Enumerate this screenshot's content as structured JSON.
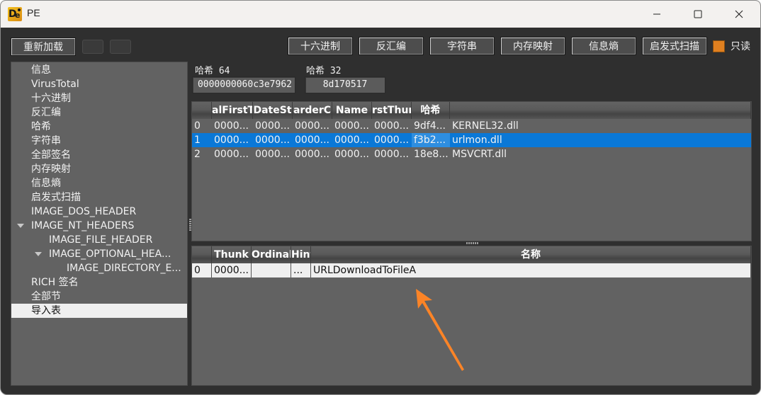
{
  "window": {
    "title": "PE",
    "controls": {
      "minimize": "—",
      "maximize": "☐",
      "close": "✕"
    }
  },
  "toolbar": {
    "reload_label": "重新加载",
    "buttons": [
      "十六进制",
      "反汇编",
      "字符串",
      "内存映射",
      "信息熵",
      "启发式扫描"
    ],
    "readonly_label": "只读",
    "readonly_checked": true,
    "readonly_color": "#e08020"
  },
  "sidebar": {
    "items": [
      {
        "label": "信息",
        "level": 0,
        "expandable": false
      },
      {
        "label": "VirusTotal",
        "level": 0,
        "expandable": false
      },
      {
        "label": "十六进制",
        "level": 0,
        "expandable": false
      },
      {
        "label": "反汇编",
        "level": 0,
        "expandable": false
      },
      {
        "label": "哈希",
        "level": 0,
        "expandable": false
      },
      {
        "label": "字符串",
        "level": 0,
        "expandable": false
      },
      {
        "label": "全部签名",
        "level": 0,
        "expandable": false
      },
      {
        "label": "内存映射",
        "level": 0,
        "expandable": false
      },
      {
        "label": "信息熵",
        "level": 0,
        "expandable": false
      },
      {
        "label": "启发式扫描",
        "level": 0,
        "expandable": false
      },
      {
        "label": "IMAGE_DOS_HEADER",
        "level": 0,
        "expandable": false
      },
      {
        "label": "IMAGE_NT_HEADERS",
        "level": 0,
        "expandable": true
      },
      {
        "label": "IMAGE_FILE_HEADER",
        "level": 1,
        "expandable": false
      },
      {
        "label": "IMAGE_OPTIONAL_HEA...",
        "level": 1,
        "expandable": true
      },
      {
        "label": "IMAGE_DIRECTORY_E...",
        "level": 2,
        "expandable": false
      },
      {
        "label": "RICH 签名",
        "level": 0,
        "expandable": false
      },
      {
        "label": "全部节",
        "level": 0,
        "expandable": false
      },
      {
        "label": "导入表",
        "level": 0,
        "expandable": false,
        "selected": true
      }
    ]
  },
  "hashes": {
    "hash64_label": "哈希 64",
    "hash64_value": "0000000060c3e7962",
    "hash32_label": "哈希 32",
    "hash32_value": "8d170517"
  },
  "imports_table": {
    "columns": [
      "",
      "alFirstT",
      "DateSt",
      "arderC",
      "Name",
      "rstThur",
      "哈希",
      ""
    ],
    "rows": [
      {
        "index": "0",
        "cells": [
          "0000...",
          "0000...",
          "0000...",
          "0000...",
          "0000..."
        ],
        "hash": "9df4...",
        "dll": "KERNEL32.dll"
      },
      {
        "index": "1",
        "cells": [
          "0000...",
          "0000...",
          "0000...",
          "0000...",
          "0000..."
        ],
        "hash": "f3b2...",
        "dll": "urlmon.dll",
        "selected": true
      },
      {
        "index": "2",
        "cells": [
          "0000...",
          "0000...",
          "0000...",
          "0000...",
          "0000..."
        ],
        "hash": "18e8...",
        "dll": "MSVCRT.dll"
      }
    ]
  },
  "functions_table": {
    "columns": [
      "",
      "Thunk",
      "Ordinal",
      "Hint",
      "名称"
    ],
    "rows": [
      {
        "index": "0",
        "thunk": "0000...",
        "ordinal": "",
        "hint": "...",
        "name": "URLDownloadToFileA"
      }
    ]
  },
  "annotation": {
    "arrow_color": "#fb8427",
    "points_to": "URLDownloadToFileA"
  }
}
